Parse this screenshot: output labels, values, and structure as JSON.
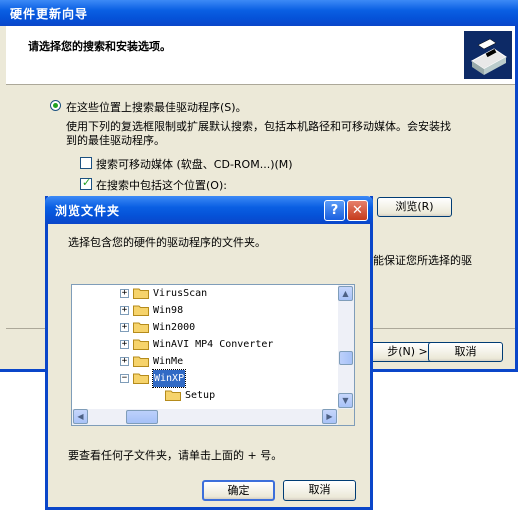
{
  "wizard": {
    "title": "硬件更新向导",
    "header": "请选择您的搜索和安装选项。",
    "option_search": "在这些位置上搜索最佳驱动程序(S)。",
    "description_line1": "使用下列的复选框限制或扩展默认搜索，包括本机路径和可移动媒体。会安装找",
    "description_line2": "到的最佳驱动程序。",
    "check_removable": "搜索可移动媒体 (软盘、CD-ROM...)(M)",
    "check_include_location": "在搜索中包括这个位置(O):",
    "browse_label": "浏览(R)",
    "side_text": "能保证您所选择的驱",
    "next_label": "步(N) >",
    "cancel_label": "取消"
  },
  "browse_dialog": {
    "title": "浏览文件夹",
    "instruction": "选择包含您的硬件的驱动程序的文件夹。",
    "hint": "要查看任何子文件夹，请单击上面的 + 号。",
    "ok_label": "确定",
    "cancel_label": "取消",
    "help_icon": "?",
    "close_icon": "✕",
    "tree": [
      {
        "label": "VirusScan",
        "expander": "+"
      },
      {
        "label": "Win98",
        "expander": "+"
      },
      {
        "label": "Win2000",
        "expander": "+"
      },
      {
        "label": "WinAVI MP4 Converter",
        "expander": "+"
      },
      {
        "label": "WinMe",
        "expander": "+"
      },
      {
        "label": "WinXP",
        "expander": "−",
        "selected": true
      },
      {
        "label": "Setup",
        "expander": ""
      }
    ]
  },
  "colors": {
    "titlebar": "#0a5fe3",
    "dialog_bg": "#ece9d8",
    "selection": "#316ac5",
    "folder": "#f6d36b"
  }
}
